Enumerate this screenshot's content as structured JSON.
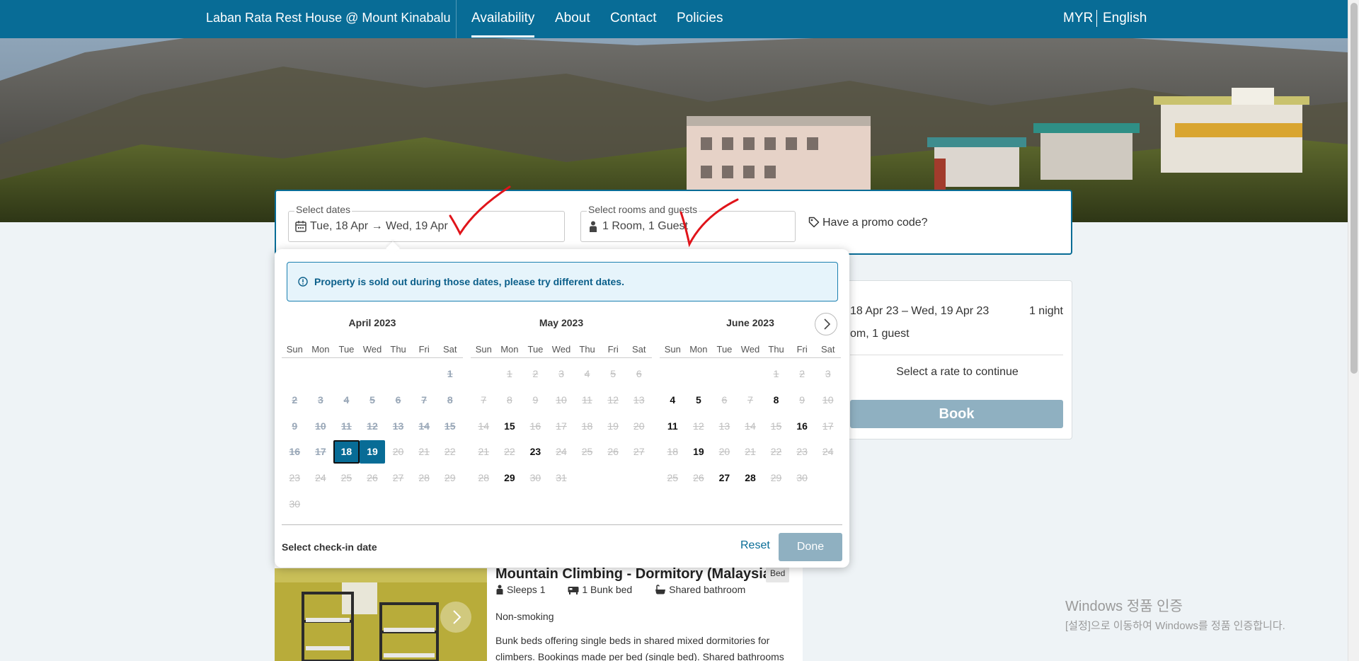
{
  "nav": {
    "brand": "Laban Rata Rest House @ Mount Kinabalu",
    "links": [
      "Availability",
      "About",
      "Contact",
      "Policies"
    ],
    "currency": "MYR",
    "language": "English"
  },
  "search": {
    "dates_label": "Select dates",
    "dates_value": "Tue, 18 Apr → Wed, 19 Apr",
    "guests_label": "Select rooms and guests",
    "guests_value": "1 Room, 1 Guest",
    "promo": "Have a promo code?"
  },
  "summary": {
    "dates": "18 Apr 23 – Wed, 19 Apr 23",
    "nights": "1 night",
    "guests": "om, 1 guest",
    "prompt": "Select a rate to continue",
    "book": "Book"
  },
  "room": {
    "title": "Mountain Climbing - Dormitory (Malaysian)",
    "badge": "Bed",
    "sleeps": "Sleeps 1",
    "bed": "1 Bunk bed",
    "bathroom": "Shared bathroom",
    "smoking": "Non-smoking",
    "desc_line1": "Bunk beds offering single beds in shared mixed dormitories for",
    "desc_line2": "climbers. Bookings made per bed (single bed). Shared bathrooms an..."
  },
  "calendar": {
    "alert": "Property is sold out during those dates, please try different dates.",
    "weekdays": [
      "Sun",
      "Mon",
      "Tue",
      "Wed",
      "Thu",
      "Fri",
      "Sat"
    ],
    "months": [
      {
        "title": "April 2023",
        "offset": 6,
        "days": [
          {
            "d": "1",
            "s": "past"
          },
          {
            "d": "2",
            "s": "past"
          },
          {
            "d": "3",
            "s": "past"
          },
          {
            "d": "4",
            "s": "past"
          },
          {
            "d": "5",
            "s": "past"
          },
          {
            "d": "6",
            "s": "past"
          },
          {
            "d": "7",
            "s": "past"
          },
          {
            "d": "8",
            "s": "past"
          },
          {
            "d": "9",
            "s": "past"
          },
          {
            "d": "10",
            "s": "past"
          },
          {
            "d": "11",
            "s": "past"
          },
          {
            "d": "12",
            "s": "past"
          },
          {
            "d": "13",
            "s": "past"
          },
          {
            "d": "14",
            "s": "past"
          },
          {
            "d": "15",
            "s": "past"
          },
          {
            "d": "16",
            "s": "past"
          },
          {
            "d": "17",
            "s": "past"
          },
          {
            "d": "18",
            "s": "sel start"
          },
          {
            "d": "19",
            "s": "sel"
          },
          {
            "d": "20",
            "s": "dis"
          },
          {
            "d": "21",
            "s": "dis"
          },
          {
            "d": "22",
            "s": "dis"
          },
          {
            "d": "23",
            "s": "dis"
          },
          {
            "d": "24",
            "s": "dis"
          },
          {
            "d": "25",
            "s": "dis"
          },
          {
            "d": "26",
            "s": "dis"
          },
          {
            "d": "27",
            "s": "dis"
          },
          {
            "d": "28",
            "s": "dis"
          },
          {
            "d": "29",
            "s": "dis"
          },
          {
            "d": "30",
            "s": "dis"
          }
        ]
      },
      {
        "title": "May 2023",
        "offset": 1,
        "days": [
          {
            "d": "1",
            "s": "dis"
          },
          {
            "d": "2",
            "s": "dis"
          },
          {
            "d": "3",
            "s": "dis"
          },
          {
            "d": "4",
            "s": "dis"
          },
          {
            "d": "5",
            "s": "dis"
          },
          {
            "d": "6",
            "s": "dis"
          },
          {
            "d": "7",
            "s": "dis"
          },
          {
            "d": "8",
            "s": "dis"
          },
          {
            "d": "9",
            "s": "dis"
          },
          {
            "d": "10",
            "s": "dis"
          },
          {
            "d": "11",
            "s": "dis"
          },
          {
            "d": "12",
            "s": "dis"
          },
          {
            "d": "13",
            "s": "dis"
          },
          {
            "d": "14",
            "s": "dis"
          },
          {
            "d": "15",
            "s": "avail"
          },
          {
            "d": "16",
            "s": "dis"
          },
          {
            "d": "17",
            "s": "dis"
          },
          {
            "d": "18",
            "s": "dis"
          },
          {
            "d": "19",
            "s": "dis"
          },
          {
            "d": "20",
            "s": "dis"
          },
          {
            "d": "21",
            "s": "dis"
          },
          {
            "d": "22",
            "s": "dis"
          },
          {
            "d": "23",
            "s": "avail"
          },
          {
            "d": "24",
            "s": "dis"
          },
          {
            "d": "25",
            "s": "dis"
          },
          {
            "d": "26",
            "s": "dis"
          },
          {
            "d": "27",
            "s": "dis"
          },
          {
            "d": "28",
            "s": "dis"
          },
          {
            "d": "29",
            "s": "avail"
          },
          {
            "d": "30",
            "s": "dis"
          },
          {
            "d": "31",
            "s": "dis"
          }
        ]
      },
      {
        "title": "June 2023",
        "offset": 4,
        "days": [
          {
            "d": "1",
            "s": "dis"
          },
          {
            "d": "2",
            "s": "dis"
          },
          {
            "d": "3",
            "s": "dis"
          },
          {
            "d": "4",
            "s": "avail"
          },
          {
            "d": "5",
            "s": "avail"
          },
          {
            "d": "6",
            "s": "dis"
          },
          {
            "d": "7",
            "s": "dis"
          },
          {
            "d": "8",
            "s": "avail"
          },
          {
            "d": "9",
            "s": "dis"
          },
          {
            "d": "10",
            "s": "dis"
          },
          {
            "d": "11",
            "s": "avail"
          },
          {
            "d": "12",
            "s": "dis"
          },
          {
            "d": "13",
            "s": "dis"
          },
          {
            "d": "14",
            "s": "dis"
          },
          {
            "d": "15",
            "s": "dis"
          },
          {
            "d": "16",
            "s": "avail"
          },
          {
            "d": "17",
            "s": "dis"
          },
          {
            "d": "18",
            "s": "dis"
          },
          {
            "d": "19",
            "s": "avail"
          },
          {
            "d": "20",
            "s": "dis"
          },
          {
            "d": "21",
            "s": "dis"
          },
          {
            "d": "22",
            "s": "dis"
          },
          {
            "d": "23",
            "s": "dis"
          },
          {
            "d": "24",
            "s": "dis"
          },
          {
            "d": "25",
            "s": "dis"
          },
          {
            "d": "26",
            "s": "dis"
          },
          {
            "d": "27",
            "s": "avail"
          },
          {
            "d": "28",
            "s": "avail"
          },
          {
            "d": "29",
            "s": "dis"
          },
          {
            "d": "30",
            "s": "dis"
          }
        ]
      }
    ],
    "hint": "Select check-in date",
    "reset": "Reset",
    "done": "Done"
  },
  "watermark": {
    "line1": "Windows 정품 인증",
    "line2": "[설정]으로 이동하여 Windows를 정품 인증합니다."
  },
  "colors": {
    "brand": "#086c96",
    "disabled_button": "#8fb0c1",
    "alert_bg": "#e6f4fb",
    "annotation": "#e0141a"
  }
}
